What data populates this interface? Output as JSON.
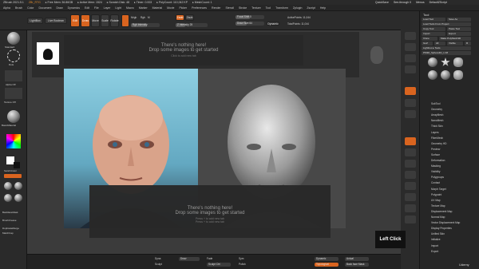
{
  "titlebar": {
    "items": [
      "ZBrush 2021.5.1",
      "ZBr_RTG",
      "▸ Free Mem: 36.86GB",
      "▸ Active Mem: 1524",
      "▸ Scratch Disk: 48",
      "▸ Timer: 0.003",
      "▸ PolyCount: 110,042 KP",
      "▸ MeshCount: 1"
    ],
    "right_items": [
      "QuickSave",
      "See-through 0",
      "Menus",
      "DefaultZScript"
    ]
  },
  "menubar": {
    "items": [
      "Alpha",
      "Brush",
      "Color",
      "Document",
      "Draw",
      "Dynamics",
      "Edit",
      "File",
      "Layer",
      "Light",
      "Macro",
      "Marker",
      "Material",
      "Movie",
      "Picker",
      "Preferences",
      "Render",
      "Stencil",
      "Stroke",
      "Texture",
      "Tool",
      "Transform",
      "Zplugin",
      "Zscript",
      "Help"
    ]
  },
  "toolbar": {
    "lightbox": "LightBox",
    "liveboolean": "Live Boolean",
    "edit": "Edit",
    "draw": "Draw",
    "move": "Move",
    "scale": "Scale",
    "rotate": "Rotate",
    "mrgb": "Mrgb",
    "rgb": "Rgb",
    "m": "M",
    "zadd": "Zadd",
    "zsub": "Zsub",
    "rgb_intensity": "Rgb Intensity",
    "z_intensity": "Z Intensity 25",
    "focal_shift": "Focal Shift 0",
    "draw_size": "Draw Size 64",
    "dynamic": "Dynamic",
    "active_points": "ActivePoints: 11,044",
    "total_points": "TotalPoints: 11,044",
    "focal_fill": 0.5,
    "draw_size_fill": 0.4
  },
  "leftshelf": {
    "labels": [
      "Standard",
      "Dots",
      "Alpha Off",
      "Texture Off",
      "BasicMaterial",
      "SwitchColor",
      "Gradient",
      "BackfaceMask",
      "BrushCrease",
      "DuplicateMerge",
      "MatchCap"
    ],
    "bottom": [
      "Stroke",
      "Fill Object"
    ]
  },
  "canvas": {
    "overlay_top": {
      "line1": "There's nothing here!",
      "line2": "Drop some images to get started",
      "hint": "Click to add new tab"
    },
    "overlay_bottom": {
      "line1": "There's nothing here!",
      "line2": "Drop some images to get started",
      "hint1": "Press + to add new tab",
      "hint2": "Press + to add new tab"
    }
  },
  "rightpanel": {
    "header": "Tool",
    "buttons": [
      "Load Tool",
      "Save As",
      "Load Tools From Project",
      "Copy Tool",
      "Paste Tool",
      "Import",
      "Export",
      "Clone",
      "Make PolyMesh3D",
      "GoZ",
      "All",
      "Visible",
      "R",
      "Lightbox ▸ Tools",
      "PM3D_Sphere3D_1 48"
    ],
    "subtool": [
      "SubTool",
      "Geometry",
      "ArrayMesh",
      "NanoMesh",
      "Thick Skin",
      "Layers",
      "FiberMesh",
      "Geometry HD",
      "Preview",
      "Surface",
      "Deformation",
      "Masking",
      "Visibility",
      "Polygroups",
      "Contact",
      "Morph Target",
      "Polypaint",
      "UV Map",
      "Texture Map",
      "Displacement Map",
      "Normal Map",
      "Vector Displacement Map",
      "Display Properties",
      "Unified Skin",
      "Initialize",
      "Import",
      "Export"
    ]
  },
  "bottombar": {
    "items": [
      "Dyna",
      "Draw",
      "Sculpt",
      "Fade",
      "Sculpt Ctrl",
      "Sym",
      "Polish",
      "Dynamic",
      "Actual",
      "Topological",
      "Back face Mask"
    ]
  },
  "overlay_label": "Left Click",
  "watermark": "Udemy",
  "colors": {
    "accent": "#d9641f"
  }
}
